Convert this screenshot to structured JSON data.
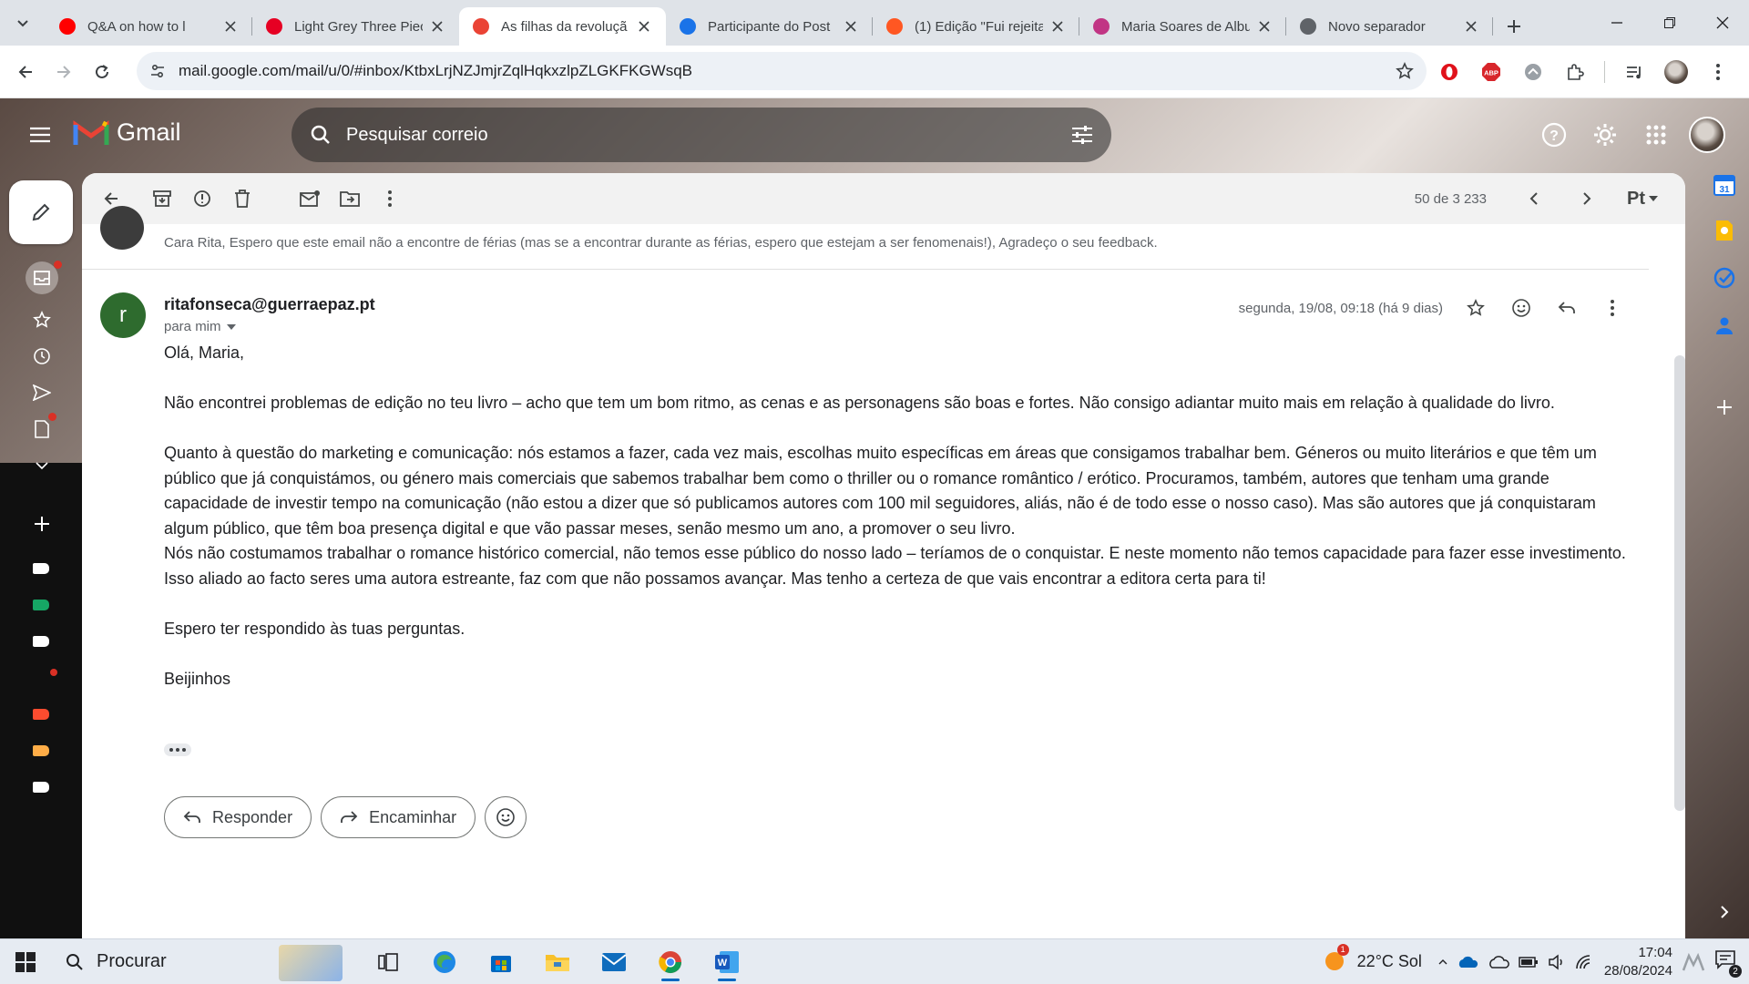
{
  "browser": {
    "tabs": [
      {
        "title": "Q&A on how to l",
        "favicon": "youtube-icon",
        "color": "#ff0000"
      },
      {
        "title": "Light Grey Three Piec",
        "favicon": "pinterest-icon",
        "color": "#e60023"
      },
      {
        "title": "As filhas da revoluçã",
        "favicon": "gmail-icon",
        "color": "#ea4335"
      },
      {
        "title": "Participante do Post",
        "favicon": "zm-icon",
        "color": "#1a73e8"
      },
      {
        "title": "(1) Edição \"Fui rejeita",
        "favicon": "blogger-icon",
        "color": "#ff5722"
      },
      {
        "title": "Maria Soares de Albu",
        "favicon": "instagram-icon",
        "color": "#c13584"
      },
      {
        "title": "Novo separador",
        "favicon": "chrome-icon",
        "color": "#5f6368"
      }
    ],
    "url": "mail.google.com/mail/u/0/#inbox/KtbxLrjNZJmjrZqlHqkxzlpZLGKFKGWsqB"
  },
  "gmail": {
    "logo_text": "Gmail",
    "search_placeholder": "Pesquisar correio",
    "pager_text": "50 de 3 233",
    "lang_label": "Pt",
    "calendar_day": "31",
    "previous_snippet": "Cara Rita, Espero que este email não a encontre de férias (mas se a encontrar durante as férias, espero que estejam a ser fenomenais!), Agradeço o seu feedback.",
    "message": {
      "avatar_letter": "r",
      "sender": "ritafonseca@guerraepaz.pt",
      "to": "para mim",
      "date": "segunda, 19/08, 09:18 (há 9 dias)",
      "greeting": "Olá, Maria,",
      "p1": "Não encontrei problemas de edição no teu livro – acho que tem um bom ritmo, as cenas e as personagens são boas e fortes. Não consigo adiantar muito mais em relação à qualidade do livro.",
      "p2": "Quanto à questão do marketing e comunicação: nós estamos a fazer, cada vez mais, escolhas muito específicas em áreas que consigamos trabalhar bem. Géneros ou muito literários e que têm um público que já conquistámos, ou género mais comerciais que sabemos trabalhar bem como o thriller ou o romance romântico / erótico. Procuramos, também, autores que tenham uma grande capacidade de investir tempo na comunicação (não estou a dizer que só publicamos autores com 100 mil seguidores, aliás, não é de todo esse o nosso caso). Mas são autores que já conquistaram algum público, que têm boa presença digital e que vão passar meses, senão mesmo um ano, a promover o seu livro.",
      "p3": "Nós não costumamos trabalhar o romance histórico comercial, não temos esse público do nosso lado – teríamos de o conquistar. E neste momento não temos capacidade para fazer esse investimento. Isso aliado ao facto seres uma autora estreante, faz com que não possamos avançar. Mas tenho a certeza de que vais encontrar a editora certa para ti!",
      "p4": "Espero ter respondido às tuas perguntas.",
      "signoff": "Beijinhos"
    },
    "reply_label": "Responder",
    "forward_label": "Encaminhar"
  },
  "taskbar": {
    "search_label": "Procurar",
    "weather_badge": "1",
    "weather": "22°C  Sol",
    "time": "17:04",
    "date": "28/08/2024",
    "notif_count": "2"
  },
  "colors": {
    "accent": "#1a73e8",
    "avatar": "#2e6b2e"
  }
}
